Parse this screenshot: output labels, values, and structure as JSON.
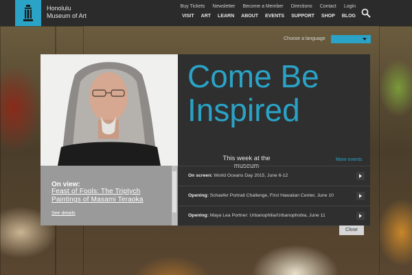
{
  "header": {
    "logo_line1": "Honolulu",
    "logo_line2": "Museum of Art",
    "utility_nav": [
      "Buy Tickets",
      "Newsletter",
      "Become a Member",
      "Directions",
      "Contact",
      "Login"
    ],
    "main_nav": [
      "VISIT",
      "ART",
      "LEARN",
      "ABOUT",
      "EVENTS",
      "SUPPORT",
      "SHOP",
      "BLOG"
    ],
    "search_icon": "search-icon"
  },
  "language": {
    "label": "Choose a language",
    "selected": ""
  },
  "modal": {
    "headline_line1": "Come Be",
    "headline_line2": "Inspired",
    "week_title": "This week at the museum",
    "more_events": "More events",
    "on_view": {
      "label": "On view:",
      "title": "Feast of Fools: The Triptych Paintings of Masami Teraoka",
      "details": "See details"
    },
    "events": [
      {
        "kind": "On screen:",
        "text": " World Oceans Day 2015, June 6-12"
      },
      {
        "kind": "Opening:",
        "text": " Schaefer Portrait Challenge, First Hawaiian Center, June 10"
      },
      {
        "kind": "Opening:",
        "text": " Maya Lea Portner: Urbanophilia/Urbanophobia, June 11"
      }
    ],
    "close": "Close"
  },
  "colors": {
    "accent": "#2aa3c6",
    "topbar": "#2b2b2b",
    "modal": "#2f2f2f"
  }
}
